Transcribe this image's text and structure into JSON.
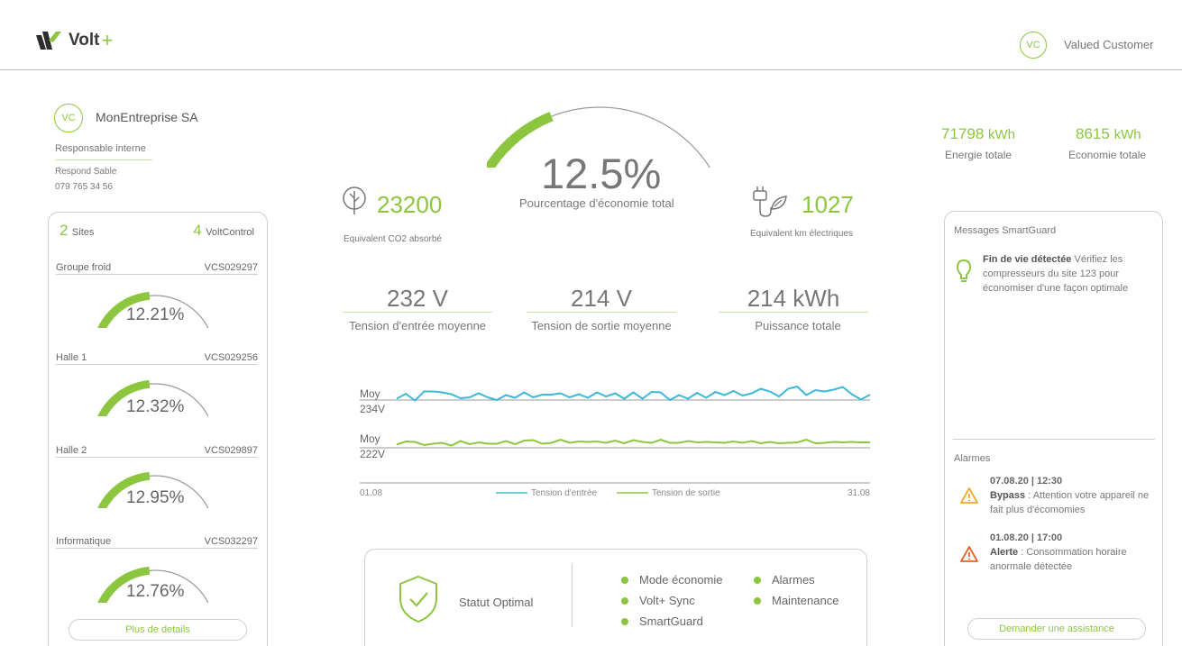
{
  "header": {
    "brand": "Volt",
    "brand_plus": "+",
    "user_initials": "VC",
    "user_name": "Valued Customer"
  },
  "company": {
    "initials": "VC",
    "name": "MonEntreprise SA",
    "responsible_title": "Responsable interne",
    "responsible_name": "Respond Sable",
    "responsible_phone": "079 765 34 56"
  },
  "sites_panel": {
    "sites_count": "2",
    "sites_label": "Sites",
    "voltcontrol_count": "4",
    "voltcontrol_label": "VoltControl",
    "sites": [
      {
        "name": "Groupe froid",
        "code": "VCS029297",
        "pct": "12.21%",
        "fraction": 0.47
      },
      {
        "name": "Halle 1",
        "code": "VCS029256",
        "pct": "12.32%",
        "fraction": 0.47
      },
      {
        "name": "Halle 2",
        "code": "VCS029897",
        "pct": "12.95%",
        "fraction": 0.47
      },
      {
        "name": "Informatique",
        "code": "VCS032297",
        "pct": "12.76%",
        "fraction": 0.47
      }
    ],
    "details_button": "Plus de details"
  },
  "summary": {
    "pct": "12.5%",
    "pct_label": "Pourcentage d'économie total",
    "pct_fraction": 0.38,
    "co2_value": "23200",
    "co2_label": "Equivalent CO2 absorbé",
    "km_value": "1027",
    "km_label": "Equivalent km électriques"
  },
  "metrics": [
    {
      "value": "232 V",
      "label": "Tension d'entrée moyenne"
    },
    {
      "value": "214 V",
      "label": "Tension de sortie moyenne"
    },
    {
      "value": "214 kWh",
      "label": "Puissance totale"
    }
  ],
  "chart_data": {
    "type": "line",
    "x_start": "01.08",
    "x_end": "31.08",
    "series": [
      {
        "name": "Tension d'entrée",
        "color": "#3cb8d8",
        "avg_label_top": "Moy",
        "avg_label_bottom": "234V",
        "values": [
          234.6,
          236.8,
          233.8,
          237.8,
          237.8,
          237.4,
          236.6,
          234.8,
          235.2,
          237.0,
          235.2,
          234.0,
          236.2,
          235.0,
          237.4,
          235.2,
          236.4,
          236.4,
          237.0,
          235.2,
          236.6,
          235.0,
          237.4,
          235.6,
          237.0,
          234.6,
          237.4,
          234.6,
          237.6,
          237.4,
          234.0,
          236.2,
          234.6,
          237.2,
          235.0,
          237.6,
          236.2,
          238.0,
          236.0,
          237.0,
          239.0,
          237.8,
          235.6,
          239.0,
          240.0,
          236.2,
          238.4,
          237.8,
          238.6,
          239.8,
          236.6,
          234.2,
          236.4
        ]
      },
      {
        "name": "Tension de sortie",
        "color": "#8cc63f",
        "avg_label_top": "Moy",
        "avg_label_bottom": "222V",
        "values": [
          223.4,
          224.8,
          224.6,
          223.2,
          223.8,
          224.2,
          223.0,
          225.0,
          223.6,
          224.4,
          223.8,
          223.8,
          225.0,
          223.6,
          225.2,
          225.4,
          223.8,
          224.2,
          225.6,
          224.2,
          224.8,
          224.6,
          224.8,
          224.2,
          225.2,
          224.0,
          225.4,
          224.6,
          224.2,
          225.6,
          224.2,
          224.2,
          225.0,
          224.4,
          224.6,
          224.4,
          224.2,
          224.8,
          224.2,
          225.0,
          224.0,
          224.6,
          224.0,
          224.2,
          224.4,
          225.6,
          224.0,
          224.2,
          224.6,
          224.4,
          224.6,
          224.4,
          224.4
        ]
      }
    ]
  },
  "status": {
    "label": "Statut Optimal",
    "items_left": [
      "Mode économie",
      "Volt+ Sync",
      "SmartGuard"
    ],
    "items_right": [
      "Alarmes",
      "Maintenance"
    ]
  },
  "totals": {
    "energy_value": "71798",
    "energy_unit": "kWh",
    "energy_label": "Energie totale",
    "saving_value": "8615",
    "saving_unit": "kWh",
    "saving_label": "Economie totale"
  },
  "messages": {
    "title": "Messages SmartGuard",
    "msg_bold": "Fin de vie détectée",
    "msg_text": " Vérifiez les compresseurs du site 123 pour économiser d'une façon optimale",
    "alarms_title": "Alarmes",
    "alarms": [
      {
        "time": "07.08.20 | 12:30",
        "kind": "Bypass",
        "text": " : Attention votre appareil ne fait plus d'écomomies",
        "color": "#f0a830"
      },
      {
        "time": "01.08.20 | 17:00",
        "kind": "Alerte",
        "text": " : Consommation horaire anormale détectée",
        "color": "#e8622a"
      }
    ],
    "assist_button": "Demander une assistance"
  }
}
